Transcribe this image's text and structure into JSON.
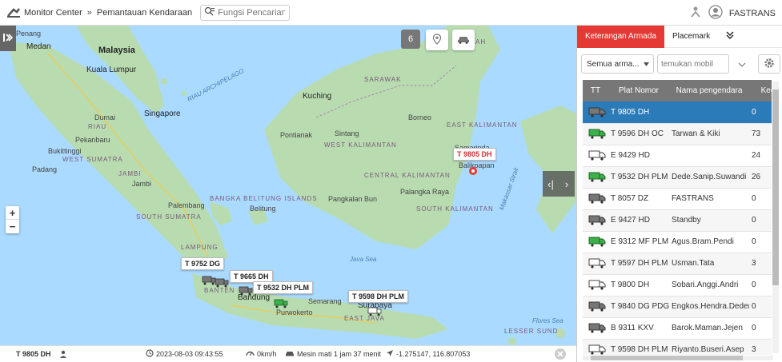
{
  "header": {
    "app_title": "Monitor Center",
    "separator": "»",
    "page_title": "Pemantauan Kendaraan",
    "search_placeholder": "Fungsi Pencarian",
    "user_name": "FASTRANS"
  },
  "map": {
    "vehicle_count_badge": "6",
    "labels": {
      "medan": "Medan",
      "malaysia": "Malaysia",
      "kuala_lumpur": "Kuala Lumpur",
      "singapore": "Singapore",
      "riau_archipelago": "RIAU ARCHIPELAGO",
      "kuching": "Kuching",
      "sarawak": "SARAWAK",
      "sabah": "SABAH",
      "samarinda": "Samarinda",
      "borneo": "Borneo",
      "east_kalimantan": "EAST KALIMANTAN",
      "pontianak": "Pontianak",
      "sintang": "Sintang",
      "west_kalimantan": "WEST KALIMANTAN",
      "central_kalimantan": "CENTRAL KALIMANTAN",
      "palangka_raya": "Palangka Raya",
      "pangkalan_bun": "Pangkalan Bun",
      "south_kalimantan": "SOUTH KALIMANTAN",
      "balikpapan": "Balikpapan",
      "makassar_strait": "Makassar Strait",
      "pekanbaru": "Pekanbaru",
      "riau": "RIAU",
      "padang": "Padang",
      "west_sumatra": "WEST SUMATRA",
      "bukittinggi": "Bukittinggi",
      "jambi": "JAMBI",
      "jambi_city": "Jambi",
      "palembang": "Palembang",
      "bangka_belitung": "BANGKA BELITUNG ISLANDS",
      "belitung": "Belitung",
      "south_sumatra": "SOUTH SUMATRA",
      "lampung": "LAMPUNG",
      "java_sea": "Java Sea",
      "banten": "BANTEN",
      "bandung": "Bandung",
      "purwokerto": "Purwokerto",
      "semarang": "Semarang",
      "surabaya": "Surabaya",
      "east_java": "EAST JAVA",
      "flores_sea": "Flores Sea",
      "lesser_sunda": "LESSER SUND",
      "penang": "Penang",
      "dumai": "Dumai"
    },
    "vehicle_markers": [
      {
        "plate": "T 9805 DH",
        "color": "red"
      },
      {
        "plate": "T 9752 DG"
      },
      {
        "plate": "T 9665 DH"
      },
      {
        "plate": "T 9532 DH PLM"
      },
      {
        "plate": "T 9598 DH PLM"
      }
    ]
  },
  "status_bar": {
    "plate": "T 9805 DH",
    "datetime": "2023-08-03 09:43:55",
    "speed": "0km/h",
    "engine": "Mesin mati 1 jam 37 menit",
    "coordinates": "-1.275147, 116.807053"
  },
  "panel": {
    "tabs": [
      "Keterangan Armada",
      "Placemark"
    ],
    "filter_select": "Semua arma...",
    "find_placeholder": "temukan mobil",
    "columns": [
      "TT",
      "Plat Nomor",
      "Nama pengendara",
      "Kece"
    ],
    "rows": [
      {
        "plate": "T 9805 DH",
        "driver": "",
        "speed": "0",
        "status": "grey",
        "selected": true
      },
      {
        "plate": "T 9596 DH OC",
        "driver": "Tarwan & Kiki",
        "speed": "73",
        "status": "green"
      },
      {
        "plate": "E 9429 HD",
        "driver": "",
        "speed": "24",
        "status": "white"
      },
      {
        "plate": "T 9532 DH PLM",
        "driver": "Dede.Sanip.Suwandi",
        "speed": "26",
        "status": "green"
      },
      {
        "plate": "T 8057 DZ",
        "driver": "FASTRANS",
        "speed": "0",
        "status": "grey"
      },
      {
        "plate": "E 9427 HD",
        "driver": "Standby",
        "speed": "0",
        "status": "grey"
      },
      {
        "plate": "E 9312 MF PLM",
        "driver": "Agus.Bram.Pendi",
        "speed": "0",
        "status": "green"
      },
      {
        "plate": "T 9597 DH PLM",
        "driver": "Usman.Tata",
        "speed": "3",
        "status": "white"
      },
      {
        "plate": "T 9800 DH",
        "driver": "Sobari.Anggi.Andri",
        "speed": "0",
        "status": "white"
      },
      {
        "plate": "T 9840 DG PDG",
        "driver": "Engkos.Hendra.Deden",
        "speed": "0",
        "status": "grey"
      },
      {
        "plate": "B 9311 KXV",
        "driver": "Barok.Maman.Jejen",
        "speed": "0",
        "status": "grey"
      },
      {
        "plate": "T 9598 DH PLM",
        "driver": "Riyanto.Buseri.Asep",
        "speed": "3",
        "status": "white"
      }
    ]
  },
  "colors": {
    "accent": "#e53935",
    "selected_row": "#2b7bb9",
    "header_bg": "#777777",
    "sea": "#aadaff",
    "land": "#b8dcb0"
  }
}
